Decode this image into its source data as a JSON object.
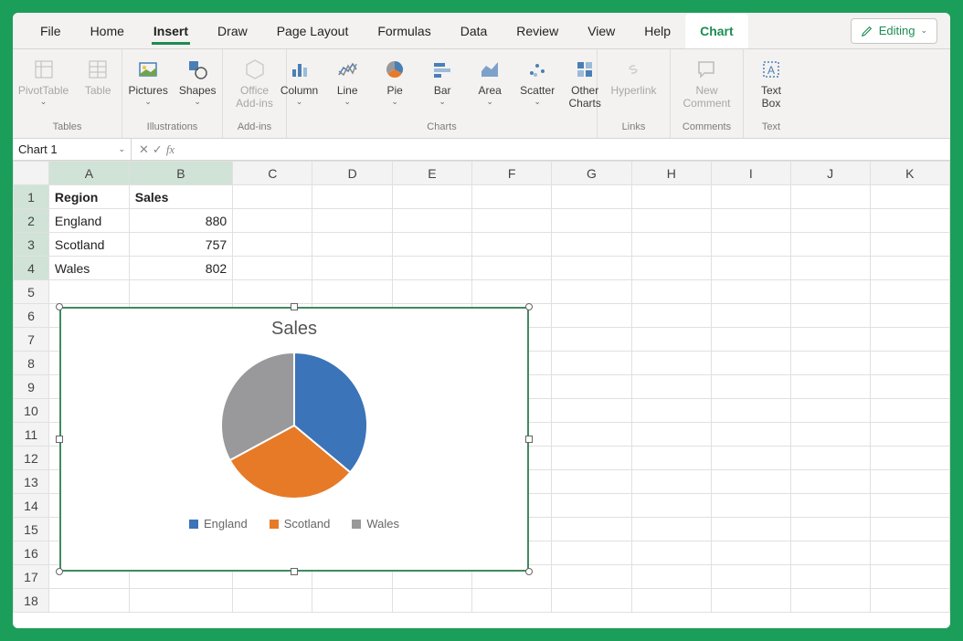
{
  "tabs": {
    "file": "File",
    "home": "Home",
    "insert": "Insert",
    "draw": "Draw",
    "page_layout": "Page Layout",
    "formulas": "Formulas",
    "data": "Data",
    "review": "Review",
    "view": "View",
    "help": "Help",
    "chart": "Chart"
  },
  "editing_button": "Editing",
  "ribbon": {
    "pivot_table": "PivotTable",
    "table": "Table",
    "tables_group": "Tables",
    "pictures": "Pictures",
    "shapes": "Shapes",
    "illustrations_group": "Illustrations",
    "office_addins": "Office\nAdd-ins",
    "addins_group": "Add-ins",
    "column": "Column",
    "line": "Line",
    "pie": "Pie",
    "bar": "Bar",
    "area": "Area",
    "scatter": "Scatter",
    "other_charts": "Other\nCharts",
    "charts_group": "Charts",
    "hyperlink": "Hyperlink",
    "links_group": "Links",
    "new_comment": "New\nComment",
    "comments_group": "Comments",
    "text_box": "Text\nBox",
    "text_group": "Text"
  },
  "namebox": "Chart 1",
  "fx": "fx",
  "columns": [
    "A",
    "B",
    "C",
    "D",
    "E",
    "F",
    "G",
    "H",
    "I",
    "J",
    "K"
  ],
  "rows": [
    "1",
    "2",
    "3",
    "4",
    "5",
    "6",
    "7",
    "8",
    "9",
    "10",
    "11",
    "12",
    "13",
    "14",
    "15",
    "16",
    "17",
    "18"
  ],
  "cells": {
    "A1": "Region",
    "B1": "Sales",
    "A2": "England",
    "B2": "880",
    "A3": "Scotland",
    "B3": "757",
    "A4": "Wales",
    "B4": "802"
  },
  "chart_data": {
    "type": "pie",
    "title": "Sales",
    "categories": [
      "England",
      "Scotland",
      "Wales"
    ],
    "values": [
      880,
      757,
      802
    ],
    "colors": [
      "#3b74b8",
      "#e67a27",
      "#99999b"
    ]
  }
}
